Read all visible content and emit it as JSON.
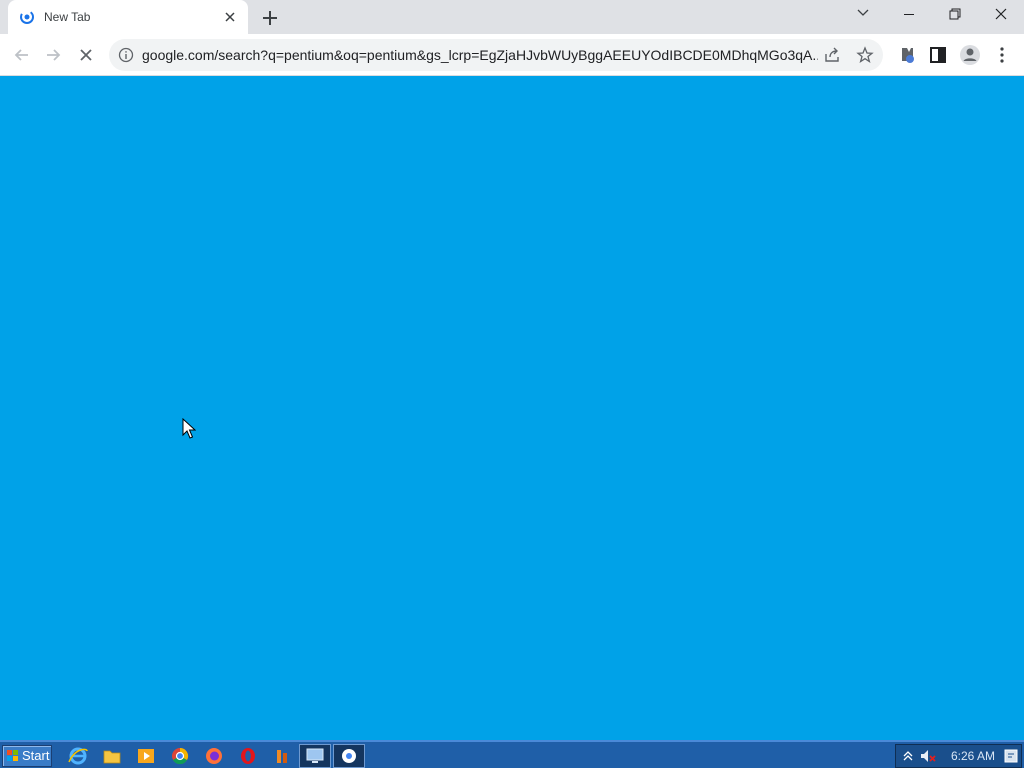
{
  "browser": {
    "tab": {
      "title": "New Tab"
    },
    "address_bar": {
      "url": "google.com/search?q=pentium&oq=pentium&gs_lcrp=EgZjaHJvbWUyBggAEEUYOdIBCDE0MDhqMGo3qA..."
    },
    "page": {
      "background_color": "#00a2e8"
    },
    "icons": [
      "favicon-icon",
      "close-tab-icon",
      "new-tab-icon",
      "tab-search-icon",
      "minimize-icon",
      "restore-icon",
      "close-icon",
      "back-icon",
      "forward-icon",
      "stop-loading-icon",
      "info-icon",
      "share-icon",
      "star-icon",
      "extensions-icon",
      "side-panel-icon",
      "profile-icon",
      "menu-icon"
    ]
  },
  "taskbar": {
    "start_label": "Start",
    "apps": [
      "ie-icon",
      "folder-icon",
      "media-player-icon",
      "chrome-icon",
      "firefox-icon",
      "opera-icon",
      "app-icon"
    ],
    "tasks": [
      "desktop-task",
      "chrome-task"
    ],
    "clock": "6:26 AM",
    "colors": {
      "bar": "#1f5fa8",
      "start": "#3a7cc7"
    }
  }
}
